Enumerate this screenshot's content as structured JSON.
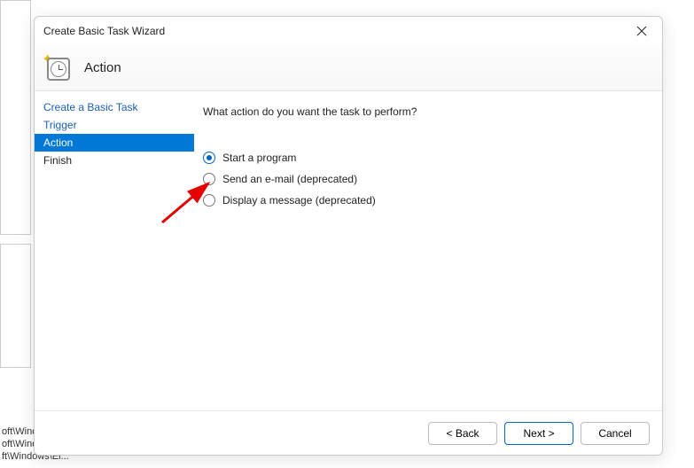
{
  "bg": {
    "row1": "oft\\Winde",
    "row2": "oft\\Windows\\C...",
    "row3": "ft\\Windows\\El..."
  },
  "dialog": {
    "title": "Create Basic Task Wizard",
    "header": "Action",
    "nav": {
      "items": [
        {
          "label": "Create a Basic Task",
          "active": false
        },
        {
          "label": "Trigger",
          "active": false
        },
        {
          "label": "Action",
          "active": true
        },
        {
          "label": "Finish",
          "active": false
        }
      ]
    },
    "prompt": "What action do you want the task to perform?",
    "options": [
      {
        "label": "Start a program",
        "checked": true
      },
      {
        "label": "Send an e-mail (deprecated)",
        "checked": false
      },
      {
        "label": "Display a message (deprecated)",
        "checked": false
      }
    ],
    "buttons": {
      "back": "< Back",
      "next": "Next >",
      "cancel": "Cancel"
    }
  }
}
